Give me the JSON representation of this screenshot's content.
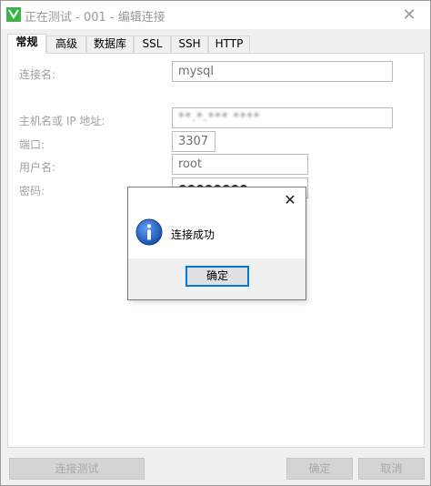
{
  "window": {
    "title": "正在测试 - 001 - 编辑连接"
  },
  "tabs": [
    {
      "label": "常规",
      "active": true
    },
    {
      "label": "高级",
      "active": false
    },
    {
      "label": "数据库",
      "active": false
    },
    {
      "label": "SSL",
      "active": false
    },
    {
      "label": "SSH",
      "active": false
    },
    {
      "label": "HTTP",
      "active": false
    }
  ],
  "form": {
    "connection_name_label": "连接名:",
    "connection_name_value": "mysql",
    "host_label": "主机名或 IP 地址:",
    "host_value": "**.*.*** ****",
    "port_label": "端口:",
    "port_value": "3307",
    "username_label": "用户名:",
    "username_value": "root",
    "password_label": "密码:",
    "password_value": "●●●●●●●●"
  },
  "footer": {
    "test_connection_label": "连接测试",
    "ok_label": "确定",
    "cancel_label": "取消"
  },
  "dialog": {
    "message": "连接成功",
    "ok_label": "确定",
    "close_glyph": "✕",
    "icon": "info-icon"
  },
  "colors": {
    "accent": "#0078d7",
    "info_icon": "#1b5fc5"
  }
}
